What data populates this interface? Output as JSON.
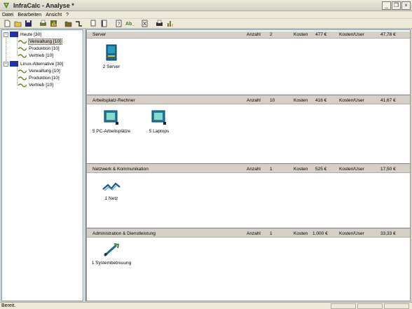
{
  "window": {
    "title": "InfraCalc - Analyse *"
  },
  "menu": [
    "Datei",
    "Bearbeiten",
    "Ansicht",
    "?"
  ],
  "toolbar": {
    "icons": [
      "new-icon",
      "open-icon",
      "save-icon",
      "print-icon",
      "chart-icon",
      "folder-icon",
      "step-icon",
      "copy-icon",
      "paste-icon",
      "info-icon",
      "ab-label-icon",
      "close-doc-icon",
      "print-preview-icon",
      "report-chart-icon"
    ],
    "ab_label": "Ab_"
  },
  "tree": {
    "groups": [
      {
        "label": "Heute [30]",
        "children": [
          "Verwaltung [10]",
          "Produktion [10]",
          "Vertrieb [10]"
        ]
      },
      {
        "label": "Linux-Alternative [30]",
        "children": [
          "Verwaltung [10]",
          "Produktion [10]",
          "Vertrieb [10]"
        ]
      }
    ],
    "selected": "Verwaltung [10]"
  },
  "categories": [
    {
      "name": "Server",
      "count_label": "Anzahl",
      "count": "2",
      "cost_label": "Kosten",
      "cost": "477 €",
      "per_user_label": "Kosten/User",
      "per_user": "47,78 €",
      "items": [
        {
          "label": "2 Server",
          "icon": "server-icon"
        }
      ]
    },
    {
      "name": "Arbeitsplatz-Rechner",
      "count_label": "Anzahl",
      "count": "10",
      "cost_label": "Kosten",
      "cost": "416 €",
      "per_user_label": "Kosten/User",
      "per_user": "41,67 €",
      "items": [
        {
          "label": "5 PC-Arbeitsplätze",
          "icon": "pc-icon"
        },
        {
          "label": "5 Laptops",
          "icon": "laptop-icon"
        }
      ]
    },
    {
      "name": "Netzwerk & Kommunikation",
      "count_label": "Anzahl",
      "count": "1",
      "cost_label": "Kosten",
      "cost": "525 €",
      "per_user_label": "Kosten/User",
      "per_user": "17,50 €",
      "items": [
        {
          "label": "1 Netz",
          "icon": "network-icon"
        }
      ]
    },
    {
      "name": "Administration & Dienstleistung",
      "count_label": "Anzahl",
      "count": "1",
      "cost_label": "Kosten",
      "cost": "1.000 €",
      "per_user_label": "Kosten/User",
      "per_user": "33,33 €",
      "items": [
        {
          "label": "1 Systembetreuung",
          "icon": "service-tool-icon"
        }
      ]
    }
  ],
  "status": {
    "text": "Bereit."
  },
  "colors": {
    "folder_blue": "#2233aa",
    "teal": "#1a7fa0",
    "wave_olive": "#7a7a20",
    "header_gray": "#d4d0c8"
  }
}
